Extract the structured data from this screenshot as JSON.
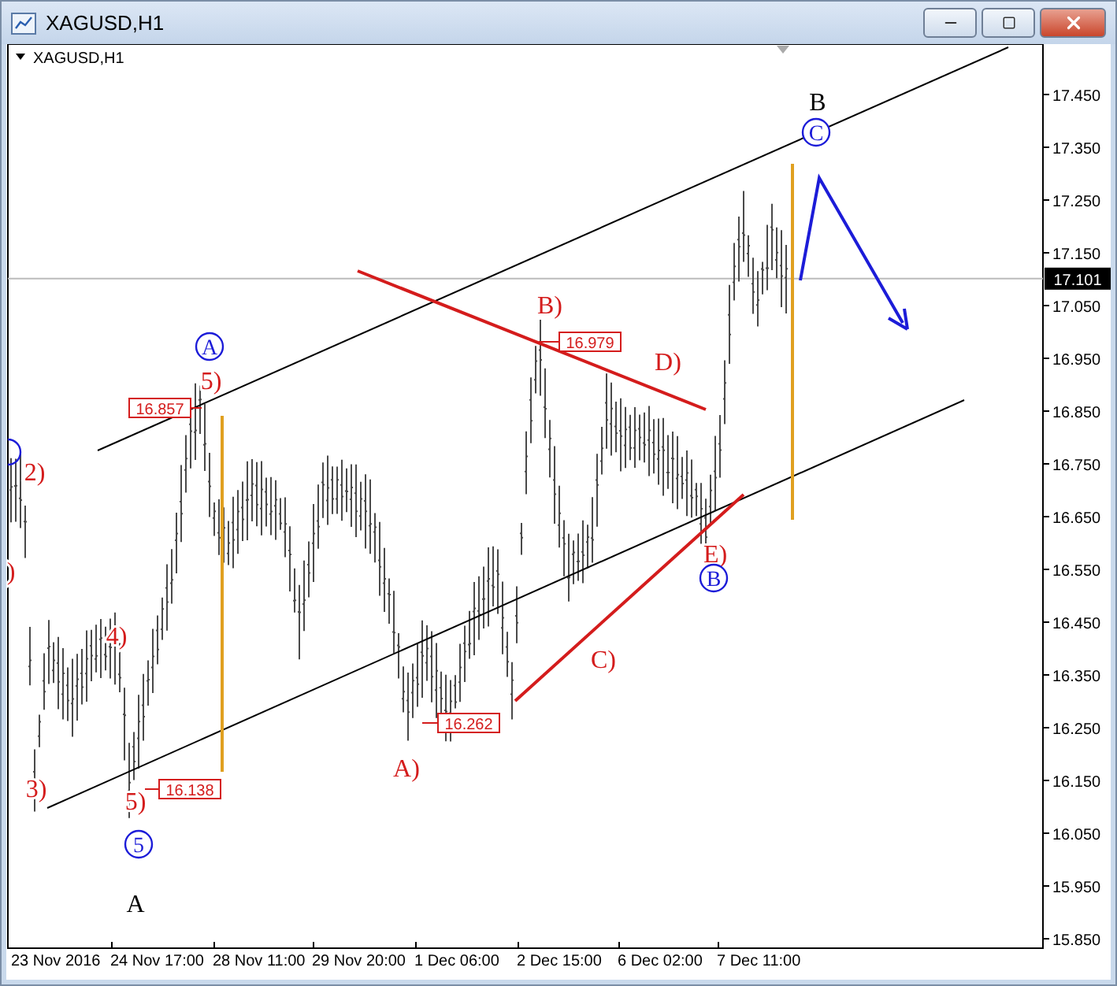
{
  "window": {
    "title": "XAGUSD,H1"
  },
  "chart": {
    "symbol_label": "XAGUSD,H1",
    "price_ticks": [
      "17.450",
      "17.350",
      "17.250",
      "17.150",
      "17.050",
      "16.950",
      "16.850",
      "16.750",
      "16.650",
      "16.550",
      "16.450",
      "16.350",
      "16.250",
      "16.150",
      "16.050",
      "15.950",
      "15.850"
    ],
    "time_ticks": [
      "23 Nov 2016",
      "24 Nov 17:00",
      "28 Nov 11:00",
      "29 Nov 20:00",
      "1 Dec 06:00",
      "2 Dec 15:00",
      "6 Dec 02:00",
      "7 Dec 11:00"
    ],
    "current_price": "17.101",
    "price_tags": [
      "16.857",
      "16.979",
      "16.262",
      "16.138"
    ],
    "wave_labels": [
      {
        "text": "A",
        "kind": "circled",
        "color": "#1c1cd8"
      },
      {
        "text": "5)",
        "kind": "plain",
        "color": "#d41c1c"
      },
      {
        "text": "2)",
        "kind": "plain",
        "color": "#d41c1c"
      },
      {
        "text": ")",
        "kind": "plain",
        "color": "#d41c1c"
      },
      {
        "text": "4)",
        "kind": "plain",
        "color": "#d41c1c"
      },
      {
        "text": "3)",
        "kind": "plain",
        "color": "#d41c1c"
      },
      {
        "text": "5)",
        "kind": "plain",
        "color": "#d41c1c"
      },
      {
        "text": "5",
        "kind": "circled",
        "color": "#1c1cd8"
      },
      {
        "text": "A",
        "kind": "plain",
        "color": "#000000"
      },
      {
        "text": "A)",
        "kind": "plain",
        "color": "#d41c1c"
      },
      {
        "text": "B)",
        "kind": "plain",
        "color": "#d41c1c"
      },
      {
        "text": "C)",
        "kind": "plain",
        "color": "#d41c1c"
      },
      {
        "text": "D)",
        "kind": "plain",
        "color": "#d41c1c"
      },
      {
        "text": "E)",
        "kind": "plain",
        "color": "#d41c1c"
      },
      {
        "text": "B",
        "kind": "circled",
        "color": "#1c1cd8"
      },
      {
        "text": "B",
        "kind": "plain",
        "color": "#000000"
      },
      {
        "text": "C",
        "kind": "circled",
        "color": "#1c1cd8"
      }
    ]
  }
}
